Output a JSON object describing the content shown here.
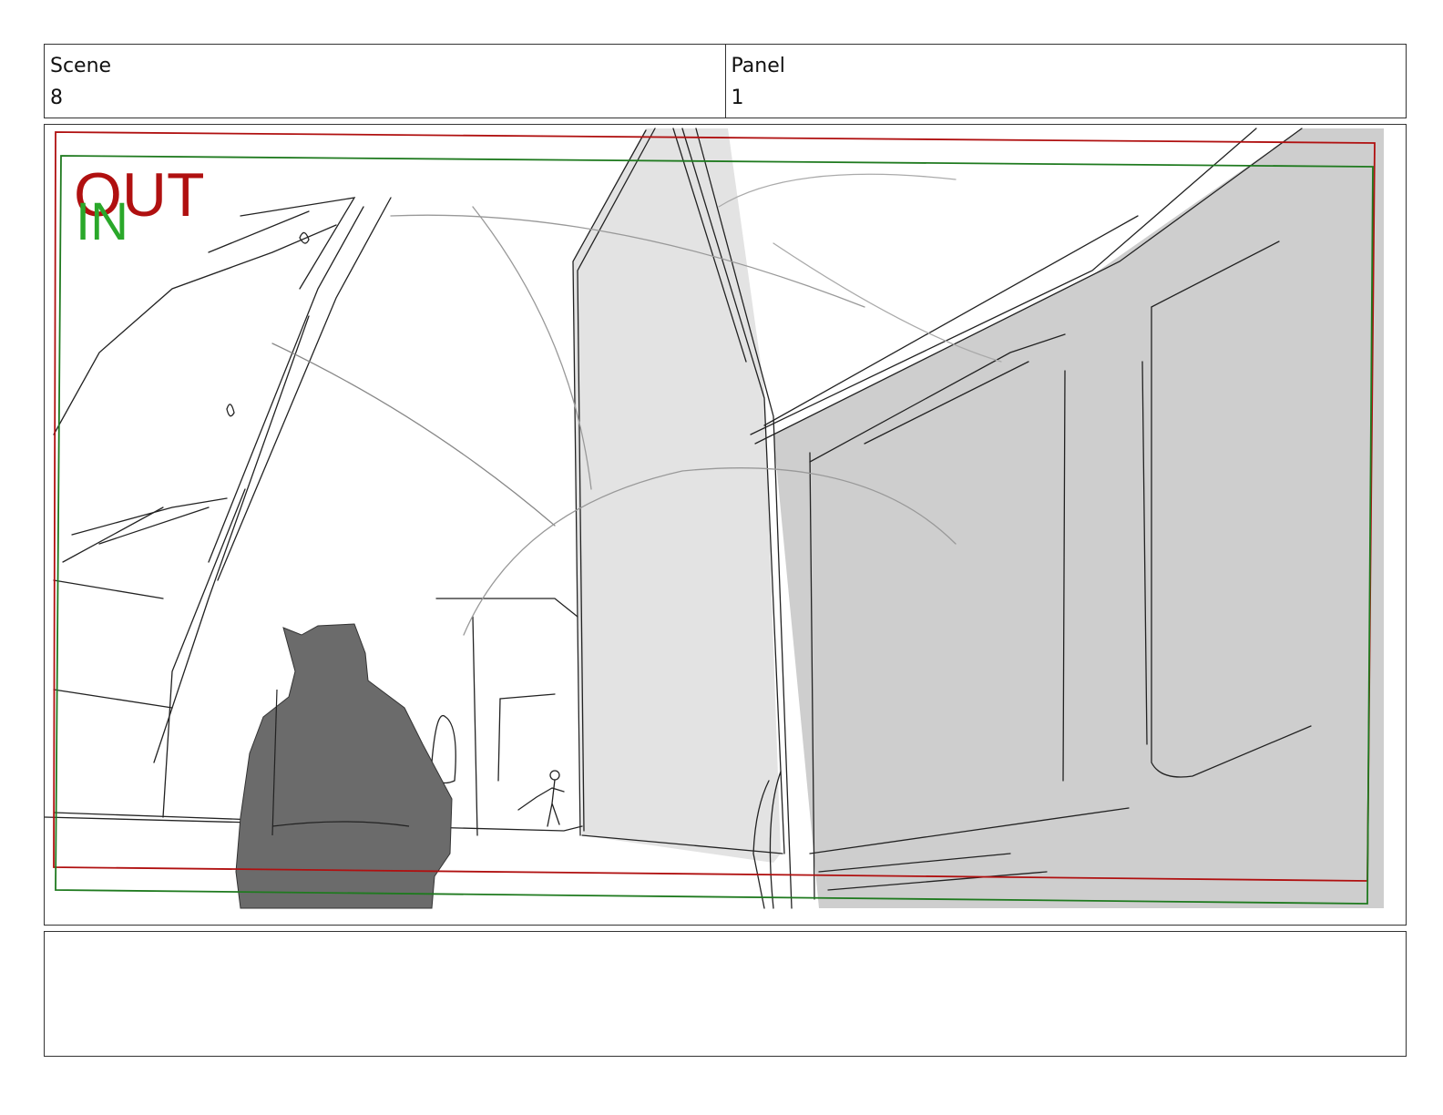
{
  "header": {
    "scene_label": "Scene",
    "scene_value": "8",
    "panel_label": "Panel",
    "panel_value": "1"
  },
  "frame_markers": {
    "out_label": "OUT",
    "in_label": "IN",
    "out_color": "#b01010",
    "in_color": "#2aa82a"
  },
  "safe_lines": {
    "red": "#b01010",
    "green": "#1f7a1f"
  },
  "sketch": {
    "character_fill": "#6b6b6b",
    "wall_fill_dark": "#cecece",
    "wall_fill_light": "#e3e3e3",
    "line_color": "#222222"
  },
  "notes": {
    "text": ""
  }
}
